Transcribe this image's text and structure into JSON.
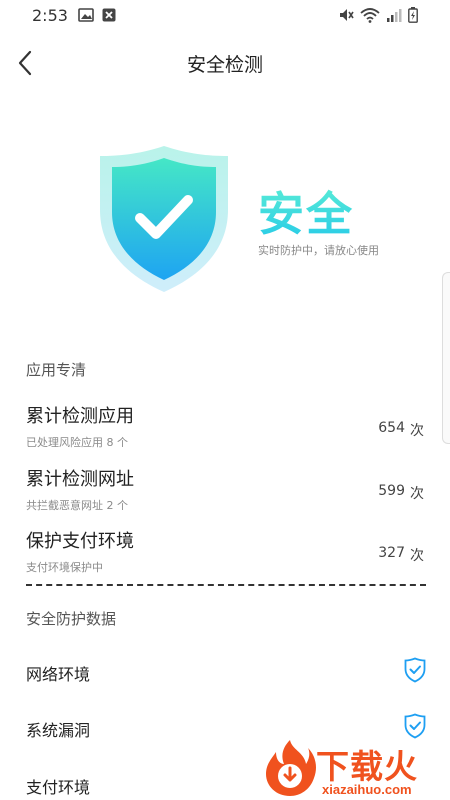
{
  "status_bar": {
    "time": "2:53"
  },
  "header": {
    "title": "安全检测"
  },
  "hero": {
    "status": "安全",
    "subtitle": "实时防护中，请放心使用"
  },
  "app_section": {
    "label": "应用专清",
    "stats": [
      {
        "title": "累计检测应用",
        "subtitle": "已处理风险应用 8 个",
        "count": "654",
        "unit": "次"
      },
      {
        "title": "累计检测网址",
        "subtitle": "共拦截恶意网址 2 个",
        "count": "599",
        "unit": "次"
      },
      {
        "title": "保护支付环境",
        "subtitle": "支付环境保护中",
        "count": "327",
        "unit": "次"
      }
    ]
  },
  "protection_section": {
    "label": "安全防护数据",
    "items": [
      {
        "label": "网络环境",
        "checked": true
      },
      {
        "label": "系统漏洞",
        "checked": true
      },
      {
        "label": "支付环境",
        "checked": true
      }
    ]
  },
  "watermark": {
    "brand": "下载火",
    "url": "xiazaihuo.com"
  },
  "colors": {
    "accent": "#1e9ff2",
    "shield_top": "#43e8c8",
    "shield_bottom": "#1fa8f0",
    "watermark": "#f0521e"
  }
}
